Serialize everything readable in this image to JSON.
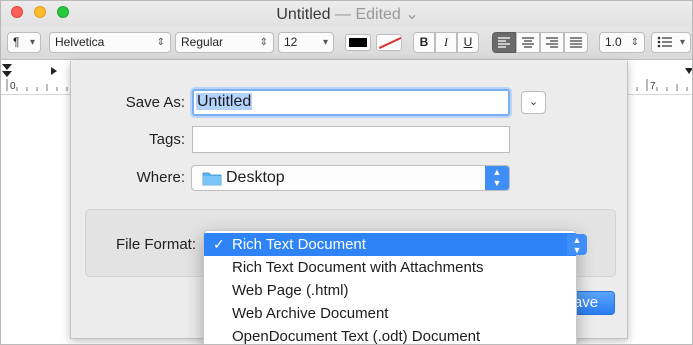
{
  "window": {
    "title": "Untitled",
    "edited_label": "— Edited",
    "title_chevron_icon": "chevron-down-icon"
  },
  "toolbar": {
    "paragraph_style": "¶",
    "font_family": "Helvetica",
    "typeface": "Regular",
    "font_size": "12",
    "text_color": "#000000",
    "bold_label": "B",
    "italic_label": "I",
    "underline_label": "U",
    "alignment_selected": "left",
    "line_spacing": "1.0",
    "list_icon": "list-bullets-icon"
  },
  "ruler": {
    "labels": [
      "0",
      "7"
    ]
  },
  "dialog": {
    "save_as_label": "Save As:",
    "save_as_value": "Untitled",
    "tags_label": "Tags:",
    "tags_value": "",
    "where_label": "Where:",
    "where_value": "Desktop",
    "where_icon": "folder-icon",
    "file_format_label": "File Format:",
    "save_button_label": "Save"
  },
  "format_menu": {
    "items": [
      {
        "label": "Rich Text Document",
        "checked": true
      },
      {
        "label": "Rich Text Document with Attachments",
        "checked": false
      },
      {
        "label": "Web Page (.html)",
        "checked": false
      },
      {
        "label": "Web Archive Document",
        "checked": false
      },
      {
        "label": "OpenDocument Text (.odt) Document",
        "checked": false
      }
    ],
    "check_mark": "✓"
  }
}
